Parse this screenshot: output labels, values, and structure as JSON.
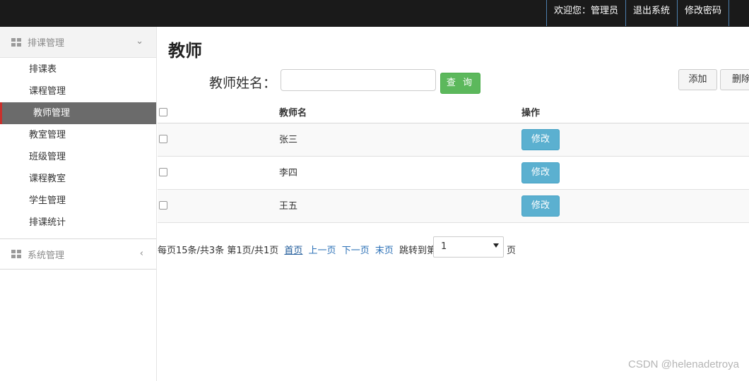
{
  "topbar": {
    "links": [
      "欢迎您：管理员",
      "退出系统",
      "修改密码"
    ]
  },
  "sidebar": {
    "group1": {
      "label": "排课管理",
      "items": [
        "排课表",
        "课程管理",
        "教师管理",
        "教室管理",
        "班级管理",
        "课程教室",
        "学生管理",
        "排课统计"
      ],
      "active_index": 2
    },
    "group2": {
      "label": "系统管理"
    }
  },
  "main": {
    "title": "教师",
    "search": {
      "label": "教师姓名：",
      "value": "",
      "button": "查 询"
    },
    "buttons": {
      "add": "添加",
      "delete": "删除"
    },
    "table": {
      "headers": [
        "",
        "教师名",
        "操作"
      ],
      "rows": [
        {
          "name": "张三",
          "action": "修改"
        },
        {
          "name": "李四",
          "action": "修改"
        },
        {
          "name": "王五",
          "action": "修改"
        }
      ]
    },
    "pagination": {
      "summary": "每页15条/共3条 第1页/共1页",
      "first": "首页",
      "prev": "上一页",
      "next": "下一页",
      "last": "末页",
      "jump_prefix": "跳转到第",
      "jump_value": "1",
      "jump_suffix": "页"
    }
  },
  "watermark": "CSDN @helenadetroya",
  "colors": {
    "topbar": "#1a1a1a",
    "active_menu": "#6b6b6b",
    "search_button": "#5cb85c",
    "edit_button": "#5bb0d0"
  }
}
